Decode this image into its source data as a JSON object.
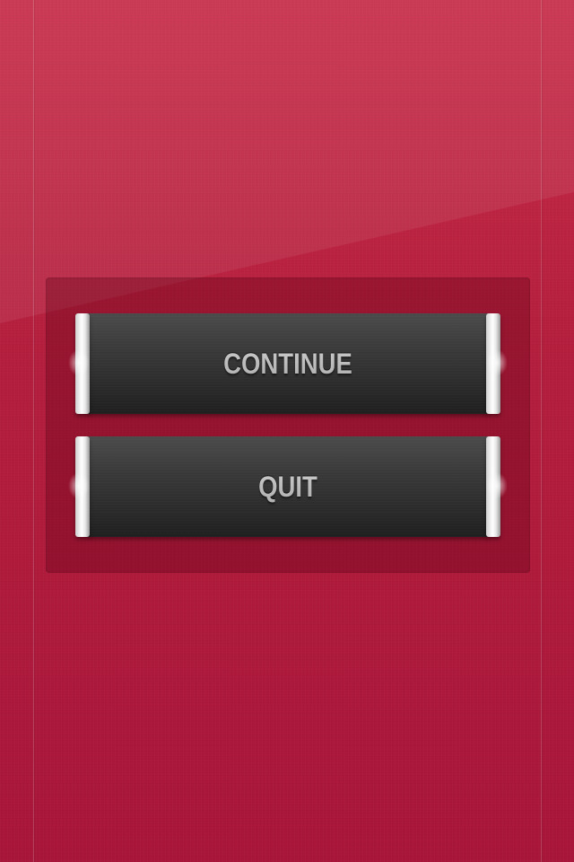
{
  "menu": {
    "continue_label": "CONTINUE",
    "quit_label": "QUIT"
  },
  "colors": {
    "background": "#b51f3e",
    "panel": "#8a0f2a",
    "button_body": "#333333",
    "button_cap": "#f2f2f2",
    "label": "#bdbdbd"
  }
}
